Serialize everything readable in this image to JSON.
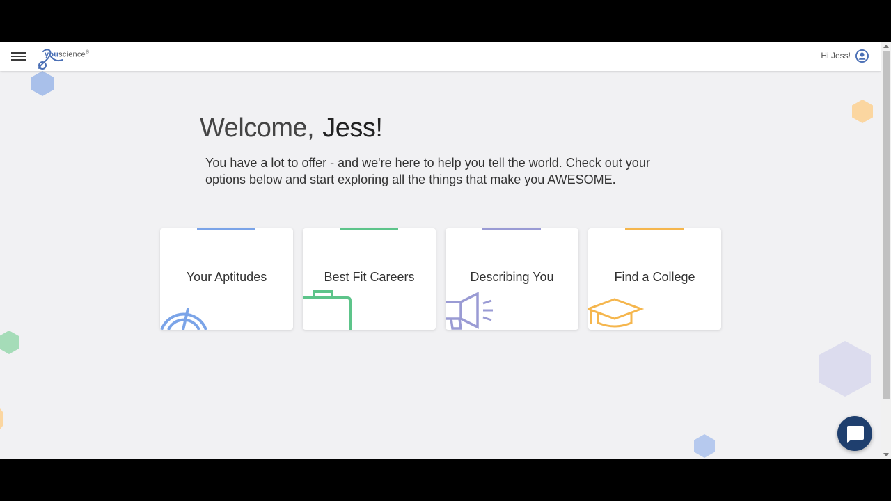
{
  "header": {
    "logo": {
      "brand_bold": "you",
      "brand_rest": "science",
      "mark": "®"
    },
    "greeting": "Hi Jess!"
  },
  "main": {
    "welcome_word": "Welcome,",
    "welcome_name": "Jess!",
    "intro": "You have a lot to offer - and we're here to help you tell the world. Check out your options below and start exploring all the things that make you AWESOME."
  },
  "cards": [
    {
      "label": "Your Aptitudes",
      "icon": "gauge-icon",
      "color": "#7ba4e8"
    },
    {
      "label": "Best Fit Careers",
      "icon": "briefcase-icon",
      "color": "#5dc48a"
    },
    {
      "label": "Describing You",
      "icon": "megaphone-icon",
      "color": "#9a9bd4"
    },
    {
      "label": "Find a College",
      "icon": "graduation-cap-icon",
      "color": "#f5b64d"
    }
  ],
  "colors": {
    "accent_orange": "#f26a25",
    "nav_dark": "#1f3f6e",
    "brand_blue": "#4a6fb5"
  }
}
